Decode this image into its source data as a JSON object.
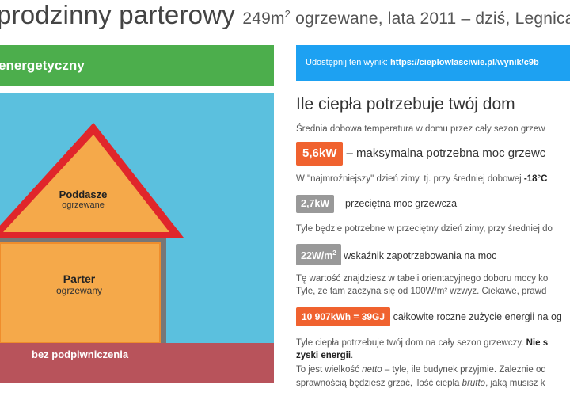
{
  "header": {
    "title": "prodzinny parterowy",
    "area": "249m",
    "area_sup": "2",
    "details": "ogrzewane, lata 2011 – dziś, Legnica"
  },
  "left": {
    "green_band": "energetyczny",
    "roof_label": "Poddasze",
    "roof_sub": "ogrzewane",
    "floor_label": "Parter",
    "floor_sub": "ogrzewany",
    "basement": "bez podpiwniczenia"
  },
  "share": {
    "prefix": "Udostępnij ten wynik:",
    "url": "https://cieplowlasciwie.pl/wynik/c9b"
  },
  "results": {
    "heading": "Ile ciepła potrzebuje twój dom",
    "avg_temp_text": "Średnia dobowa temperatura w domu przez cały sezon grzew",
    "max_power_badge": "5,6kW",
    "max_power_text": "– maksymalna potrzebna moc grzewc",
    "coldest_day_text": "W \"najmroźniejszy\" dzień zimy, tj. przy średniej dobowej",
    "coldest_day_temp": "-18°C",
    "avg_power_badge": "2,7kW",
    "avg_power_text": "– przeciętna moc grzewcza",
    "avg_day_text": "Tyle będzie potrzebne w przeciętny dzień zimy, przy średniej do",
    "index_badge": "22W/m",
    "index_badge_sup": "2",
    "index_text": "wskaźnik zapotrzebowania na moc",
    "table_text_1": "Tę wartość znajdziesz w tabeli orientacyjnego doboru mocy ko",
    "table_text_2": "Tyle, że tam zaczyna się od 100W/m² wzwyż. Ciekawe, prawd",
    "annual_badge": "10 907kWh = 39GJ",
    "annual_text": "całkowite roczne zużycie energii na og",
    "season_text": "Tyle ciepła potrzebuje twój dom na cały sezon grzewczy.",
    "season_bold": "Nie s",
    "season_bold_2": "zyski energii",
    "season_tail": ".",
    "netto_text_a": "To jest wielkość",
    "netto_word": "netto",
    "netto_text_b": "– tyle, ile budynek przyjmie. Zależnie od",
    "brutto_text_a": "sprawnością będziesz grzać, ilość ciepła",
    "brutto_word": "brutto",
    "brutto_text_b": ", jaką musisz k"
  },
  "colors": {
    "green": "#4cae4c",
    "sky": "#5bc0de",
    "ground": "#b8535b",
    "orange": "#f0622f",
    "twitter_blue": "#1da1f2",
    "roof_red": "#e0262b"
  }
}
